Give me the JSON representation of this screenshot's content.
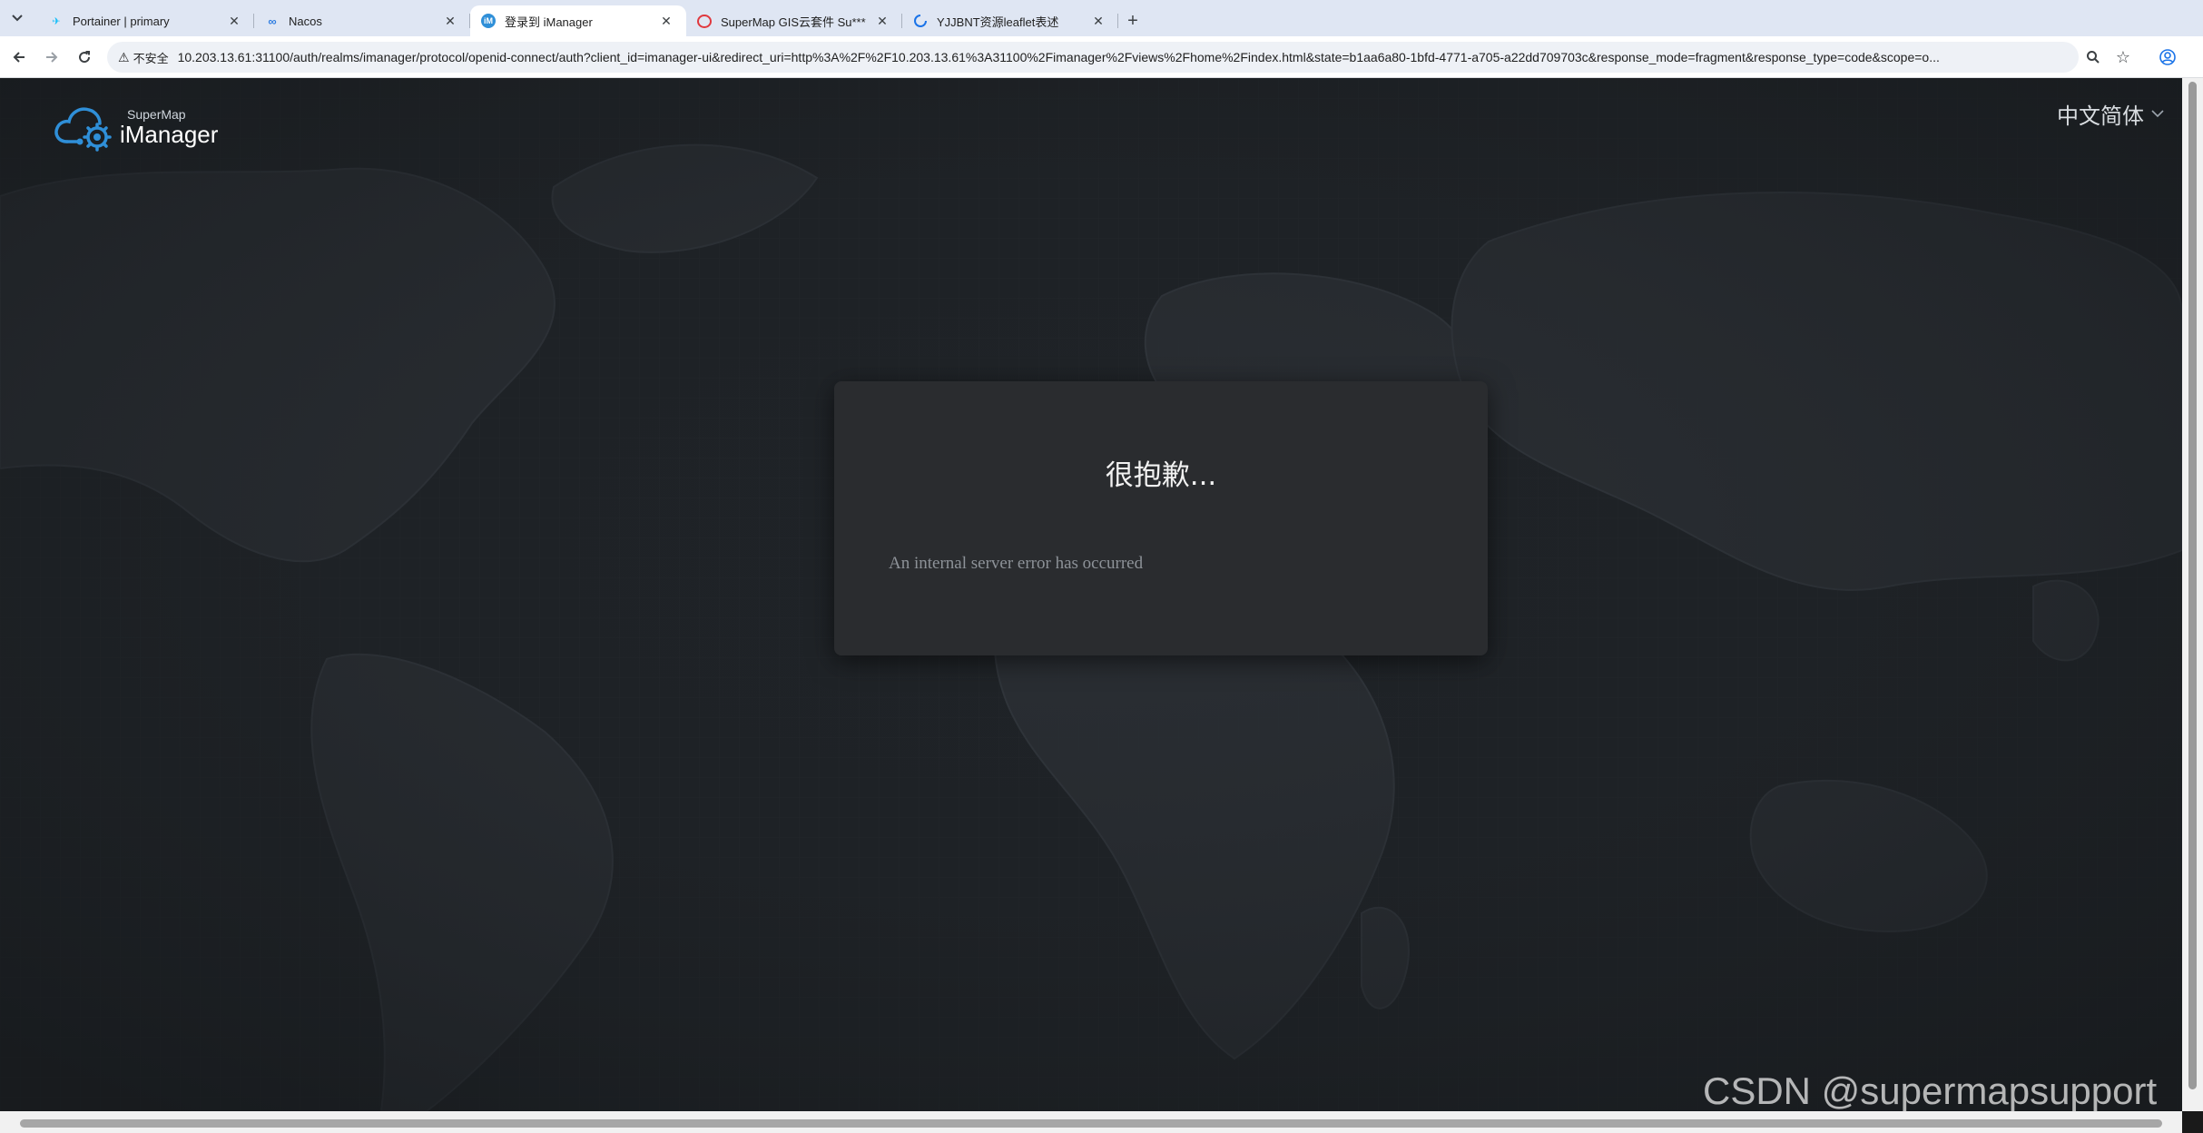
{
  "browser": {
    "tabs": [
      {
        "label": "Portainer | primary",
        "icon": "portainer-icon",
        "active": false
      },
      {
        "label": "Nacos",
        "icon": "nacos-icon",
        "active": false
      },
      {
        "label": "登录到 iManager",
        "icon": "imanager-icon",
        "active": true
      },
      {
        "label": "SuperMap GIS云套件 Su***a",
        "icon": "supermap-icon",
        "active": false
      },
      {
        "label": "YJJBNT资源leaflet表述",
        "icon": "loading-icon",
        "active": false
      }
    ],
    "security_label": "不安全",
    "url": "10.203.13.61:31100/auth/realms/imanager/protocol/openid-connect/auth?client_id=imanager-ui&redirect_uri=http%3A%2F%2F10.203.13.61%3A31100%2Fimanager%2Fviews%2Fhome%2Findex.html&state=b1aa6a80-1bfd-4771-a705-a22dd709703c&response_mode=fragment&response_type=code&scope=o..."
  },
  "header": {
    "logo_small": "SuperMap",
    "logo_big": "iManager",
    "language": "中文简体"
  },
  "dialog": {
    "title": "很抱歉...",
    "message": "An internal server error has occurred"
  },
  "watermark": "CSDN @supermapsupport",
  "colors": {
    "background": "#1e2226",
    "dialog": "#2a2c2f",
    "brand_blue": "#2f8fd8"
  }
}
